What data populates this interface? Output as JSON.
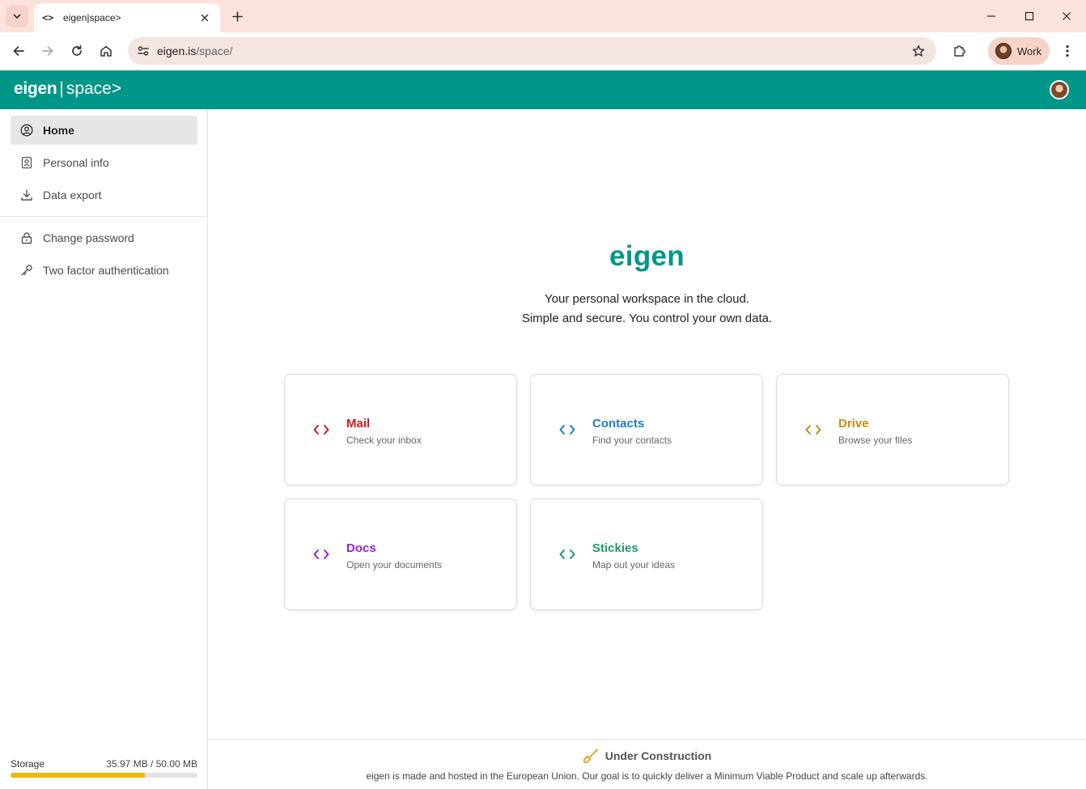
{
  "browser": {
    "tab_title": "eigen|space>",
    "favicon_glyph": "<>",
    "url_host": "eigen.is",
    "url_path": "/space/",
    "profile_label": "Work"
  },
  "app": {
    "logo_primary": "eigen",
    "logo_separator": "|",
    "logo_secondary": "space>",
    "header_color": "#009688"
  },
  "sidebar": {
    "items_top": [
      {
        "label": "Home",
        "icon": "user-circle-icon",
        "active": true
      },
      {
        "label": "Personal info",
        "icon": "contact-card-icon",
        "active": false
      },
      {
        "label": "Data export",
        "icon": "download-icon",
        "active": false
      }
    ],
    "items_bottom": [
      {
        "label": "Change password",
        "icon": "lock-icon"
      },
      {
        "label": "Two factor authentication",
        "icon": "key-icon"
      }
    ],
    "storage": {
      "label": "Storage",
      "value_text": "35.97 MB / 50.00 MB",
      "used_fraction": 0.7194,
      "bar_color": "#f2b705"
    }
  },
  "main": {
    "brand": "eigen",
    "tagline_1": "Your personal workspace in the cloud.",
    "tagline_2": "Simple and secure. You control your own data.",
    "cards": [
      {
        "title": "Mail",
        "subtitle": "Check your inbox",
        "color": "#d0191c",
        "icon": "code-brackets-icon"
      },
      {
        "title": "Contacts",
        "subtitle": "Find your contacts",
        "color": "#1a7fc1",
        "icon": "code-brackets-icon"
      },
      {
        "title": "Drive",
        "subtitle": "Browse your files",
        "color": "#c98a10",
        "icon": "code-brackets-icon"
      },
      {
        "title": "Docs",
        "subtitle": "Open your documents",
        "color": "#9b1fd3",
        "icon": "code-brackets-icon"
      },
      {
        "title": "Stickies",
        "subtitle": "Map out your ideas",
        "color": "#1a9a6a",
        "icon": "code-brackets-icon"
      }
    ]
  },
  "footer": {
    "title": "Under Construction",
    "text": "eigen is made and hosted in the European Union. Our goal is to quickly deliver a Minimum Viable Product and scale up afterwards.",
    "icon": "shovel-icon",
    "icon_color": "#e0a21a"
  }
}
